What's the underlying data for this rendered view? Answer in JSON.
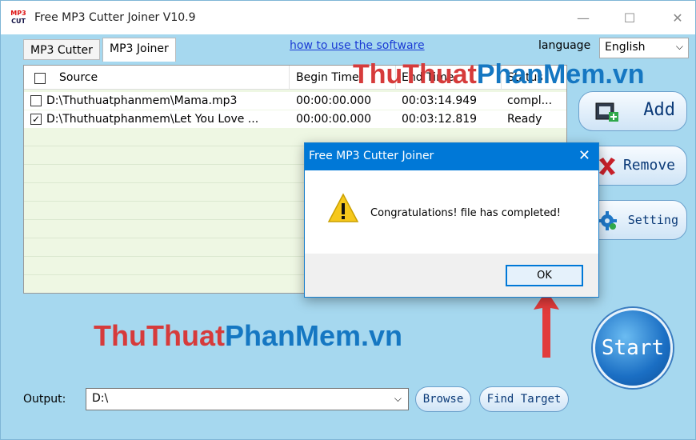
{
  "window": {
    "title": "Free MP3 Cutter Joiner V10.9",
    "icon_line1": "MP3",
    "icon_line2": "CUT",
    "minimize_glyph": "—",
    "maximize_glyph": "☐",
    "close_glyph": "✕"
  },
  "tabs": [
    {
      "label": "MP3 Cutter",
      "active": false
    },
    {
      "label": "MP3 Joiner",
      "active": true
    }
  ],
  "help_link": "how to use the software",
  "language": {
    "label": "language",
    "selected": "English"
  },
  "file_list": {
    "columns": [
      "Source",
      "Begin Time",
      "End Time",
      "Status"
    ],
    "rows": [
      {
        "checked": false,
        "source": "D:\\Thuthuatphanmem\\Mama.mp3",
        "begin": "00:00:00.000",
        "end": "00:03:14.949",
        "status": "compl..."
      },
      {
        "checked": true,
        "source": "D:\\Thuthuatphanmem\\Let You Love ...",
        "begin": "00:00:00.000",
        "end": "00:03:12.819",
        "status": "Ready"
      }
    ]
  },
  "side_buttons": {
    "add": "Add",
    "remove": "Remove",
    "setting": "Setting"
  },
  "output": {
    "label": "Output:",
    "value": "D:\\"
  },
  "buttons": {
    "browse": "Browse",
    "find_target": "Find Target",
    "start": "Start"
  },
  "watermark": {
    "part1": "ThuThuat",
    "part2": "PhanMem.vn"
  },
  "dialog": {
    "title": "Free MP3 Cutter Joiner",
    "message": "Congratulations! file has completed!",
    "ok_label": "OK"
  },
  "colors": {
    "window_bg": "#a6d8ef",
    "list_bg": "#eef7e3",
    "dialog_title_bg": "#0078d7",
    "annotation_arrow": "#e23b3b",
    "link": "#1a3bd4"
  },
  "icons": [
    "app-logo-icon",
    "add-file-icon",
    "remove-x-icon",
    "setting-gear-icon",
    "warning-icon",
    "dropdown-chevron-icon"
  ]
}
